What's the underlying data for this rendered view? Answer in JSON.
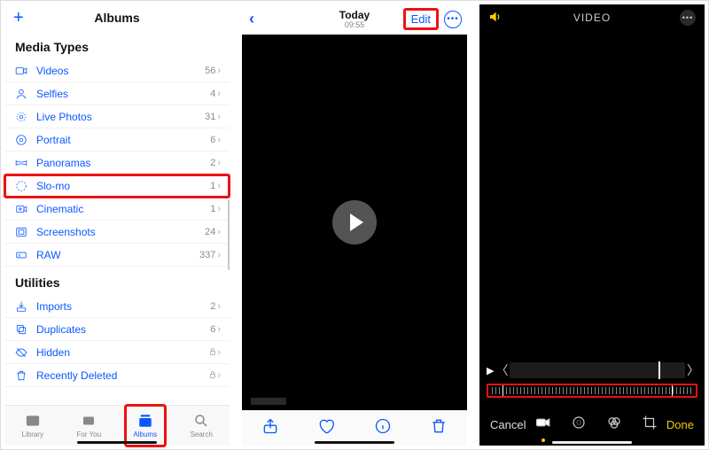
{
  "phone1": {
    "title": "Albums",
    "section1": "Media Types",
    "items": [
      {
        "label": "Videos",
        "count": "56",
        "icon": "video"
      },
      {
        "label": "Selfies",
        "count": "4",
        "icon": "selfie"
      },
      {
        "label": "Live Photos",
        "count": "31",
        "icon": "live"
      },
      {
        "label": "Portrait",
        "count": "6",
        "icon": "portrait"
      },
      {
        "label": "Panoramas",
        "count": "2",
        "icon": "pano"
      },
      {
        "label": "Slo-mo",
        "count": "1",
        "icon": "slomo",
        "highlight": true
      },
      {
        "label": "Cinematic",
        "count": "1",
        "icon": "cinematic"
      },
      {
        "label": "Screenshots",
        "count": "24",
        "icon": "screenshot"
      },
      {
        "label": "RAW",
        "count": "337",
        "icon": "raw"
      }
    ],
    "section2": "Utilities",
    "utilities": [
      {
        "label": "Imports",
        "count": "2",
        "icon": "import"
      },
      {
        "label": "Duplicates",
        "count": "6",
        "icon": "duplicate"
      },
      {
        "label": "Hidden",
        "locked": true,
        "icon": "hidden"
      },
      {
        "label": "Recently Deleted",
        "locked": true,
        "icon": "trash"
      }
    ],
    "tabs": {
      "library": "Library",
      "foryou": "For You",
      "albums": "Albums",
      "search": "Search"
    }
  },
  "phone2": {
    "title": "Today",
    "subtitle": "09:55",
    "edit": "Edit"
  },
  "phone3": {
    "title": "VIDEO",
    "cancel": "Cancel",
    "done": "Done"
  }
}
